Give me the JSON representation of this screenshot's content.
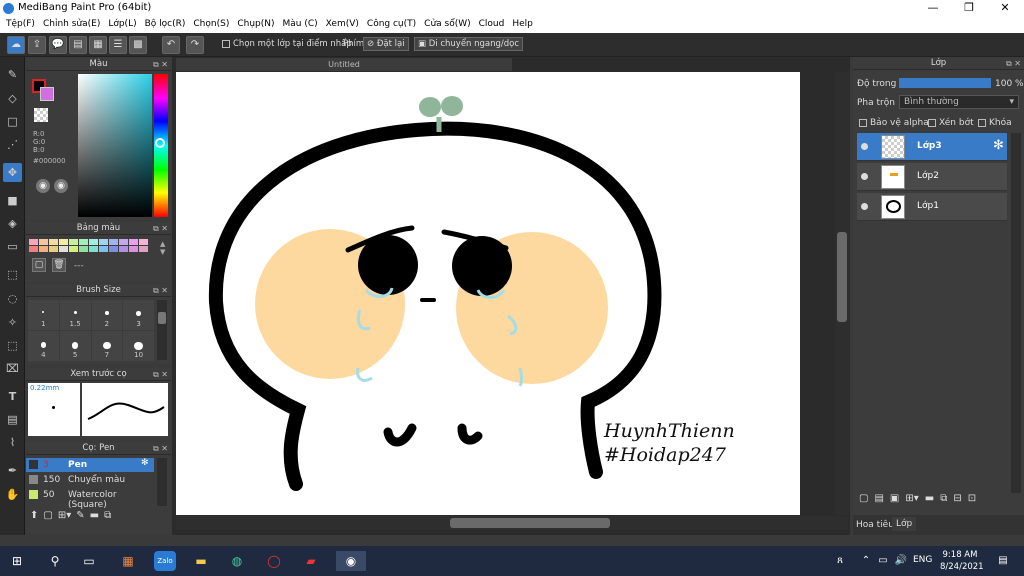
{
  "window": {
    "title": "MediBang Paint Pro (64bit)"
  },
  "menu": [
    "Tệp(F)",
    "Chỉnh sửa(E)",
    "Lớp(L)",
    "Bộ lọc(R)",
    "Chọn(S)",
    "Chụp(N)",
    "Màu (C)",
    "Xem(V)",
    "Công cụ(T)",
    "Cửa sổ(W)",
    "Cloud",
    "Help"
  ],
  "toolbar": {
    "select_layer_label": "Chọn một lớp tại điểm nhấp",
    "phim_label": "Phím",
    "reset_label": "Đặt lại",
    "move_label": "Di chuyển ngang/dọc"
  },
  "color_panel": {
    "title": "Màu",
    "r": "R:0",
    "g": "G:0",
    "b": "B:0",
    "hex": "#000000"
  },
  "palette_panel": {
    "title": "Bảng màu",
    "none_label": "---",
    "swatches": [
      "#f6a7b5",
      "#f7c4a0",
      "#f4dca0",
      "#f0f0a0",
      "#c8efa0",
      "#a0efb4",
      "#a0efe2",
      "#a0d4f0",
      "#a0b4f0",
      "#c4a7f0",
      "#e8a0ef",
      "#f5b2d6",
      "#f08080",
      "#f0b080",
      "#e6d080",
      "#e0e0e0",
      "#d0f080",
      "#90e0a0",
      "#80e0d0",
      "#80c0f0",
      "#8090e0",
      "#b090e0",
      "#e090e0",
      "#e0a0c0"
    ]
  },
  "brush_size_panel": {
    "title": "Brush Size",
    "sizes": [
      "1",
      "1.5",
      "2",
      "3",
      "4",
      "5",
      "7",
      "10"
    ]
  },
  "preview_panel": {
    "title": "Xem trước cọ",
    "size_label": "0.22mm"
  },
  "brush_panel": {
    "title": "Cọ: Pen",
    "items": [
      {
        "size": "3",
        "name": "Pen"
      },
      {
        "size": "150",
        "name": "Chuyển màu"
      },
      {
        "size": "50",
        "name": "Watercolor (Square)"
      }
    ]
  },
  "document": {
    "tab": "Untitled",
    "signature_line1": "HuynhThienn",
    "signature_line2": "#Hoidap247"
  },
  "layer_panel": {
    "title": "Lớp",
    "opacity_label": "Độ trong",
    "opacity_value": "100 %",
    "opacity_fraction": 1.0,
    "blend_label": "Pha trộn",
    "blend_value": "Bình thường",
    "protect_alpha": "Bảo vệ alpha",
    "clip": "Xén bớt",
    "lock": "Khóa",
    "layers": [
      "Lớp3",
      "Lớp2",
      "Lớp1"
    ],
    "tab_navigator": "Hoa tiêu",
    "tab_layer": "Lớp"
  },
  "taskbar": {
    "language": "ENG",
    "time": "9:18 AM",
    "date": "8/24/2021"
  },
  "colors": {
    "accent": "#3a7bc8",
    "cheek": "#fdd9a0",
    "tear": "#a6dce8",
    "leaf": "#8fb69b"
  }
}
